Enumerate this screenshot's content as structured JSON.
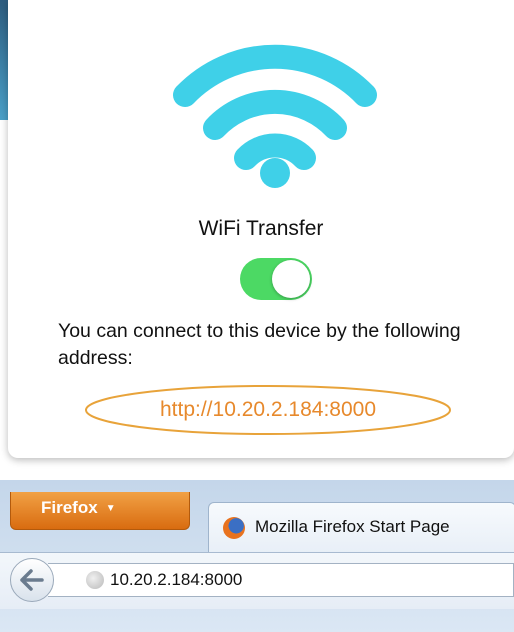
{
  "app": {
    "wifi_icon": "wifi-icon",
    "title": "WiFi Transfer",
    "toggle_on": true,
    "description": "You can connect to this device by the following address:",
    "address": "http://10.20.2.184:8000",
    "colors": {
      "wifi": "#3fd0e8",
      "toggle": "#4cd964",
      "address": "#e7892c"
    }
  },
  "browser": {
    "menu_label": "Firefox",
    "menu_icon": "chevron-down-icon",
    "tab_icon": "firefox-icon",
    "tab_title": "Mozilla Firefox Start Page",
    "back_icon": "back-arrow-icon",
    "site_icon": "globe-icon",
    "url": "10.20.2.184:8000"
  }
}
